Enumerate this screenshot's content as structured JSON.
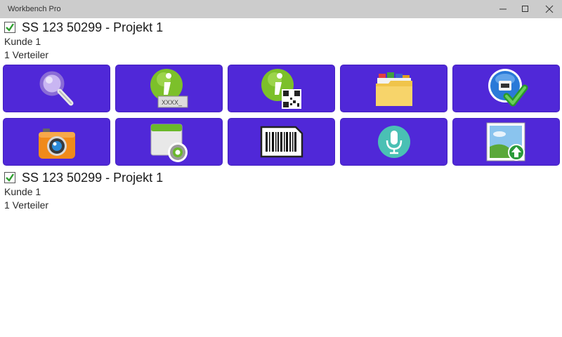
{
  "window": {
    "title": "Workbench Pro",
    "controls": [
      "minimize",
      "maximize",
      "close"
    ]
  },
  "projects": [
    {
      "checked": true,
      "title": "SS 123 50299 - Projekt 1",
      "customer": "Kunde 1",
      "distributors": "1 Verteiler"
    },
    {
      "checked": true,
      "title": "SS 123 50299 - Projekt 1",
      "customer": "Kunde 1",
      "distributors": "1 Verteiler"
    }
  ],
  "tiles": [
    {
      "icon": "magnifier-icon"
    },
    {
      "icon": "info-text-icon",
      "caption": "XXXX_"
    },
    {
      "icon": "info-qr-icon"
    },
    {
      "icon": "file-folder-icon"
    },
    {
      "icon": "network-check-icon"
    },
    {
      "icon": "camera-icon"
    },
    {
      "icon": "window-settings-icon"
    },
    {
      "icon": "barcode-icon"
    },
    {
      "icon": "microphone-icon"
    },
    {
      "icon": "image-upload-icon"
    }
  ],
  "colors": {
    "tile_background": "#5028d8",
    "titlebar": "#cccccc",
    "checkbox_check": "#2e9e2e"
  }
}
